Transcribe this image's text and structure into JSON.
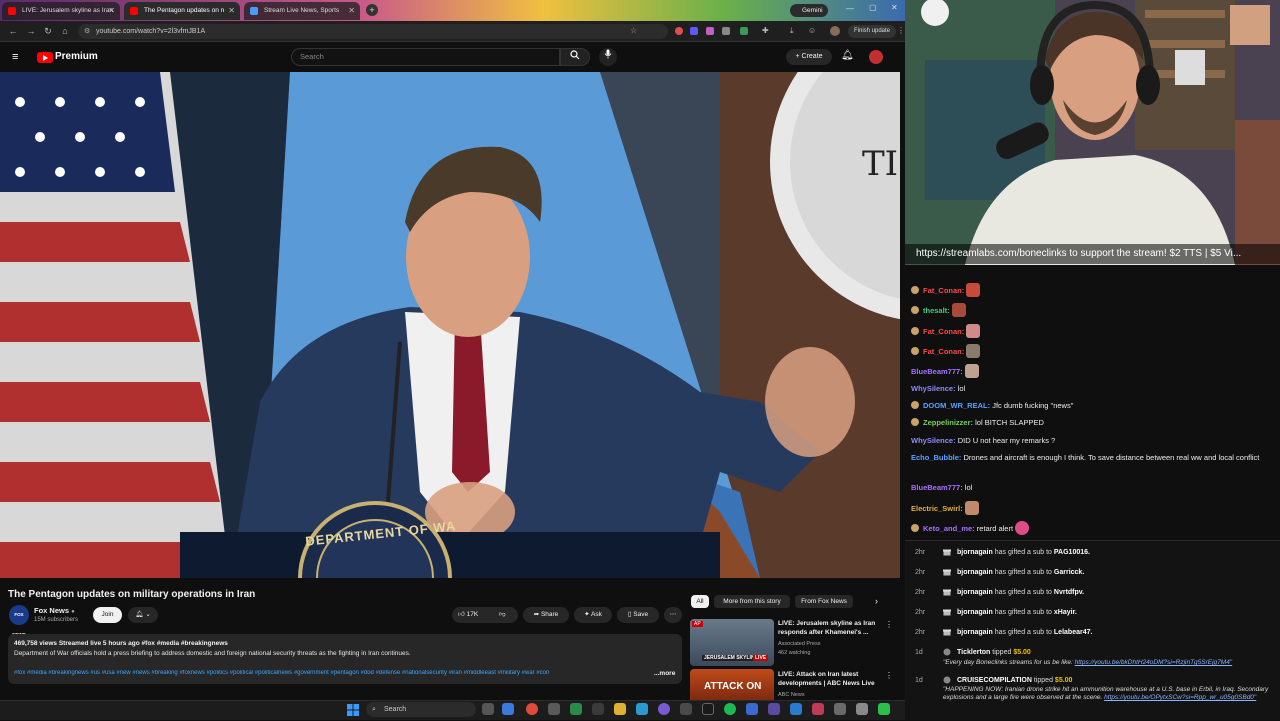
{
  "browser": {
    "tabs": [
      {
        "label": "LIVE: Jerusalem skyline as Iran"
      },
      {
        "label": "The Pentagon updates on n"
      },
      {
        "label": "Stream Live News, Sports"
      }
    ],
    "url": "youtube.com/watch?v=2l3vfmJB1A",
    "gemini_label": "Gemini",
    "finish_update": "Finish update"
  },
  "youtube": {
    "logo_text": "Premium",
    "search_placeholder": "Search",
    "create_label": "Create"
  },
  "video": {
    "title": "The Pentagon updates on military operations in Iran",
    "channel": {
      "name": "Fox News",
      "subscribers": "15M subscribers",
      "avatar_text": "FOX NEWS"
    },
    "join_label": "Join",
    "likes": "17K",
    "share_label": "Share",
    "ask_label": "Ask",
    "save_label": "Save",
    "description": {
      "stats": "469,758 views  Streamed live 5 hours ago  #fox #media #breakingnews",
      "text": "Department of War officials hold a press briefing to address domestic and foreign national security threats as the fighting in Iran continues.",
      "tags": "#fox #media #breakingnews #us #usa #new #news #breaking #foxnews #politics #political #politicalnews #government #pentagon #dod #defense #nationalsecurity #iran #middleeast #military #war #con",
      "more_label": "...more"
    },
    "podium_text": "DEPARTMENT OF WA",
    "backdrop_text": "TI"
  },
  "recommendations": {
    "chips": [
      "All",
      "More from this story",
      "From Fox News"
    ],
    "items": [
      {
        "title": "LIVE: Jerusalem skyline as Iran responds after Khamenei's ...",
        "channel": "Associated Press",
        "meta": "462 watching",
        "thumb_text": "JERUSALEM SKYLINE",
        "badge": "LIVE",
        "ap": "AP"
      },
      {
        "title": "LIVE: Attack on Iran latest developments | ABC News Live",
        "channel": "ABC News",
        "meta": "",
        "thumb_text": "ATTACK ON"
      }
    ]
  },
  "stream": {
    "banner": "https://streamlabs.com/boneclinks to support the stream! $2 TTS | $5 Vi...",
    "chat": [
      {
        "user": "Fat_Conan:",
        "color": "#ff4a4a",
        "text": "",
        "emote": "#c84a3a"
      },
      {
        "user": "thesalt:",
        "color": "#3ad07a",
        "text": "",
        "emote": "#a84a3a"
      },
      {
        "user": "Fat_Conan:",
        "color": "#ff4a4a",
        "text": "",
        "emote": "#d08a8a"
      },
      {
        "user": "Fat_Conan:",
        "color": "#ff4a4a",
        "text": "",
        "emote": "#8a7a6a"
      },
      {
        "user": "BlueBeam777:",
        "color": "#a970ff",
        "text": "",
        "emote": "#c0a090"
      },
      {
        "user": "WhySilence:",
        "color": "#8a8aff",
        "text": "lol"
      },
      {
        "user": "DOOM_WR_REAL:",
        "color": "#5aa0ff",
        "text": "Jfc dumb fucking \"news\""
      },
      {
        "user": "Zeppelinizzer:",
        "color": "#7ad05a",
        "text": "lol BITCH SLAPPED"
      },
      {
        "user": "WhySilence:",
        "color": "#8a8aff",
        "text": "DID U not hear my remarks ?"
      },
      {
        "user": "Echo_Bubble:",
        "color": "#5aa0ff",
        "text": "Drones and aircraft is enough I think. To save distance between real ww and local conflict"
      },
      {
        "user": "BlueBeam777:",
        "color": "#a970ff",
        "text": "lol"
      },
      {
        "user": "Electric_Swirl:",
        "color": "#e0b040",
        "text": "",
        "emote": "#c08a6a"
      },
      {
        "user": "Keto_and_me:",
        "color": "#a970ff",
        "text": "retard alert",
        "emote": "#e04a8a"
      }
    ],
    "events": [
      {
        "time": "2hr",
        "user": "bjornagain",
        "text": "has gifted a sub to",
        "target": "PAG10016."
      },
      {
        "time": "2hr",
        "user": "bjornagain",
        "text": "has gifted a sub to",
        "target": "Garricck."
      },
      {
        "time": "2hr",
        "user": "bjornagain",
        "text": "has gifted a sub to",
        "target": "Nvrtdfpv."
      },
      {
        "time": "2hr",
        "user": "bjornagain",
        "text": "has gifted a sub to",
        "target": "xHayir."
      },
      {
        "time": "2hr",
        "user": "bjornagain",
        "text": "has gifted a sub to",
        "target": "Lelabear47."
      }
    ],
    "tips": [
      {
        "time": "1d",
        "user": "Ticklerton",
        "amount": "$5.00",
        "message": "\"Every day Boneclinks streams for us be like: ",
        "link": "https://youtu.be/bkDhtH24oDM?si=RzjinTg5SrEjg7M4\""
      },
      {
        "time": "1d",
        "user": "CRUISECOMPILATION",
        "amount": "$5.00",
        "message": "\"HAPPENING NOW: Iranian drone strike hit an ammunition warehouse at a U.S. base in Erbil, in Iraq. Secondary explosions and a large fire were observed at the scene. ",
        "link": "https://youtu.be/OPytxSCw?si=Rpp_wr_u05g0SBd0\""
      }
    ],
    "tipped_label": "tipped"
  },
  "taskbar": {
    "search_placeholder": "Search"
  }
}
